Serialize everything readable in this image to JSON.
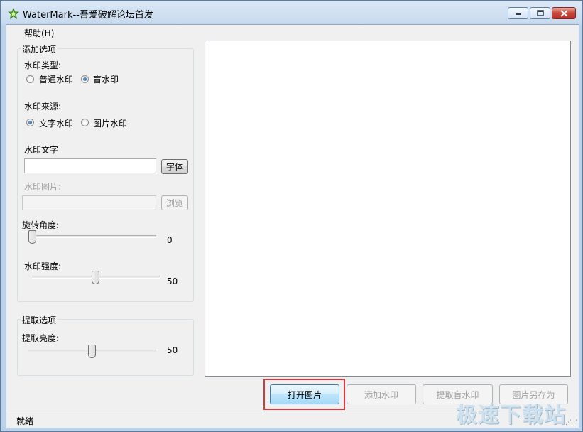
{
  "window": {
    "title": "WaterMark--吾爱破解论坛首发"
  },
  "menu": {
    "help": "帮助(H)"
  },
  "add_options": {
    "group_title": "添加选项",
    "watermark_type_label": "水印类型:",
    "type_normal": "普通水印",
    "type_blind": "盲水印",
    "type_selected": "盲水印",
    "watermark_source_label": "水印来源:",
    "source_text": "文字水印",
    "source_image": "图片水印",
    "source_selected": "文字水印",
    "watermark_text_label": "水印文字",
    "watermark_text_value": "",
    "font_button": "字体",
    "watermark_image_label": "水印图片:",
    "watermark_image_value": "",
    "browse_button": "浏览",
    "rotation_label": "旋转角度:",
    "rotation_value": "0",
    "strength_label": "水印强度:",
    "strength_value": "50"
  },
  "extract_options": {
    "group_title": "提取选项",
    "brightness_label": "提取亮度:",
    "brightness_value": "50"
  },
  "actions": {
    "open_image": "打开图片",
    "add_watermark": "添加水印",
    "extract_watermark": "提取盲水印",
    "save_as": "图片另存为"
  },
  "status": {
    "text": "就绪"
  },
  "overlay": {
    "watermark_text": "极速下载站"
  },
  "colors": {
    "highlight": "#d9393e",
    "window_frame": "#bcd2ea"
  }
}
